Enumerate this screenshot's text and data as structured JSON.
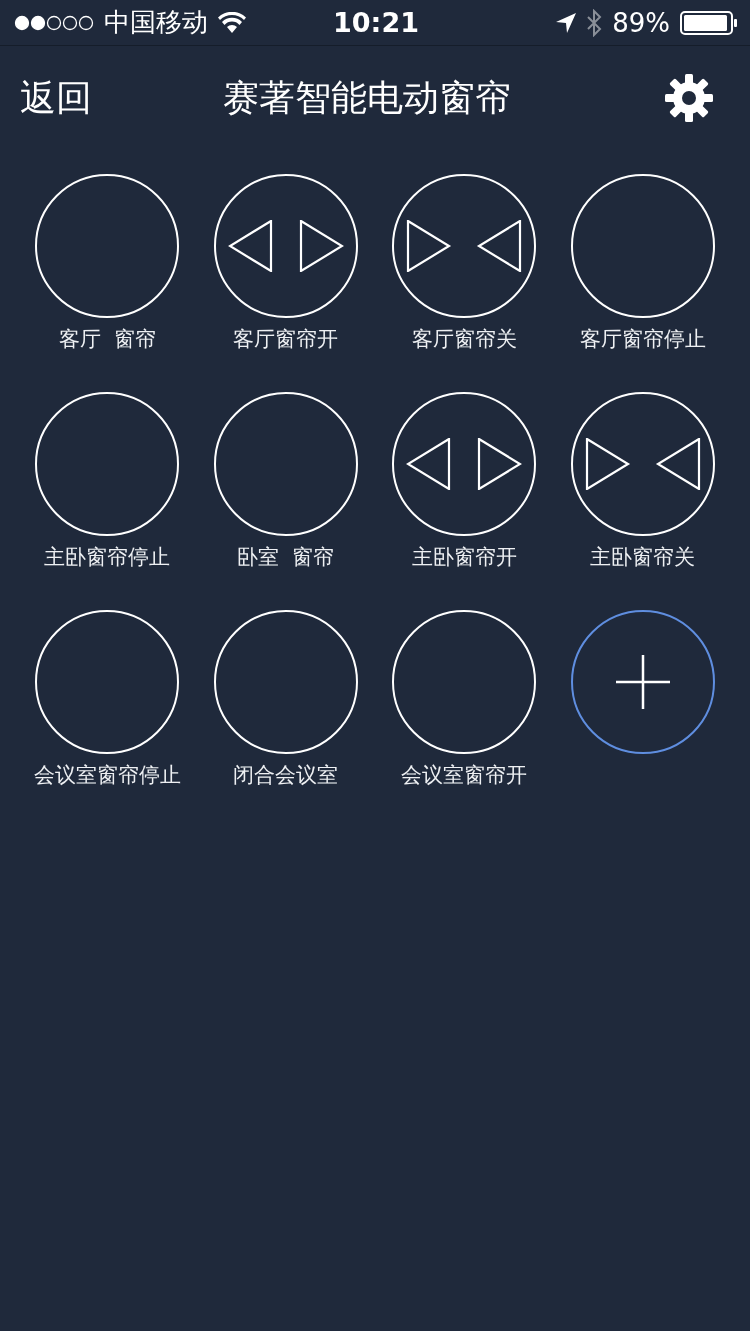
{
  "status_bar": {
    "carrier": "中国移动",
    "time": "10:21",
    "battery": "89%"
  },
  "nav": {
    "back": "返回",
    "title": "赛著智能电动窗帘"
  },
  "buttons": [
    {
      "kind": "blank",
      "label": "客厅  窗帘"
    },
    {
      "kind": "open",
      "label": "客厅窗帘开"
    },
    {
      "kind": "close",
      "label": "客厅窗帘关"
    },
    {
      "kind": "blank",
      "label": "客厅窗帘停止"
    },
    {
      "kind": "blank",
      "label": "主卧窗帘停止"
    },
    {
      "kind": "blank",
      "label": "卧室  窗帘"
    },
    {
      "kind": "open",
      "label": "主卧窗帘开"
    },
    {
      "kind": "close",
      "label": "主卧窗帘关"
    },
    {
      "kind": "blank",
      "label": "会议室窗帘停止"
    },
    {
      "kind": "blank",
      "label": "闭合会议室"
    },
    {
      "kind": "blank",
      "label": "会议室窗帘开"
    },
    {
      "kind": "add"
    }
  ]
}
